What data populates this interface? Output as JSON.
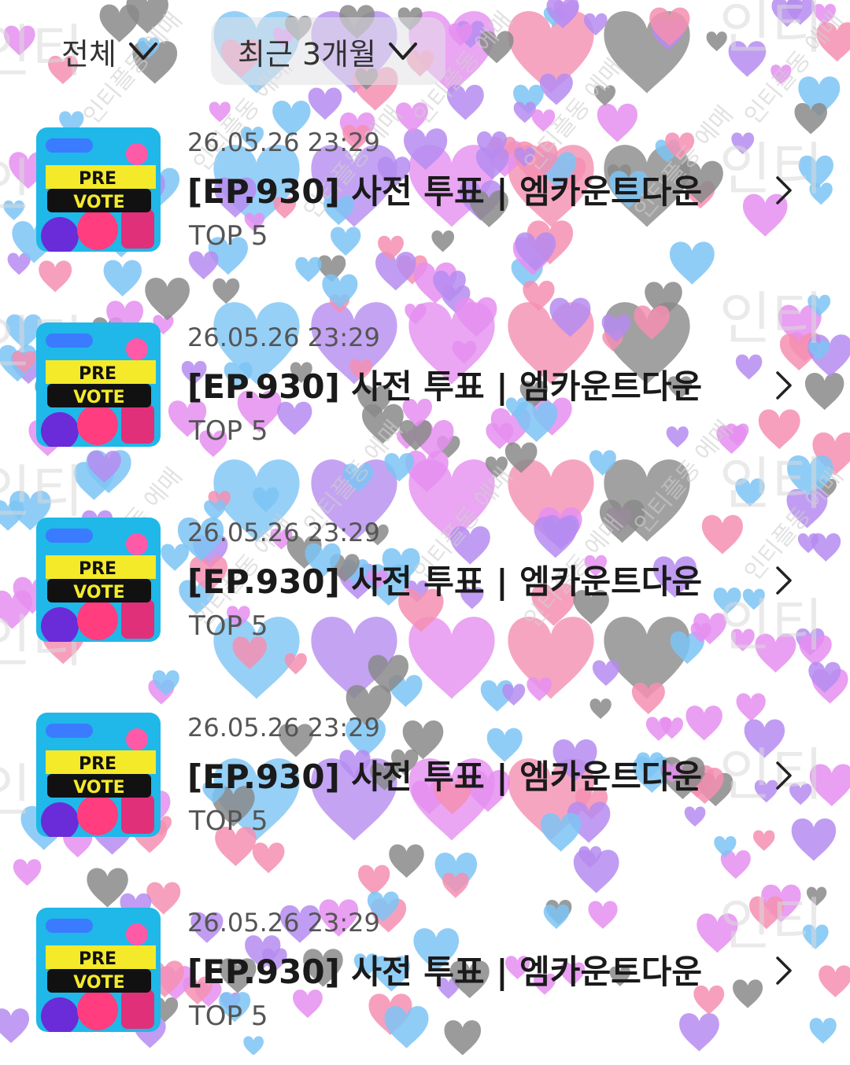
{
  "filters": {
    "type": {
      "label": "전체",
      "icon": "chevron-down-icon"
    },
    "period": {
      "label": "최근 3개월",
      "icon": "chevron-down-icon"
    }
  },
  "vote_history": [
    {
      "date": "26.05.26 23:29",
      "title": "[EP.930] 사전 투표 | 엠카운트다운",
      "detail": "TOP 5",
      "thumbnail_text": [
        "PRE",
        "VOTE"
      ],
      "icon": "chevron-right-icon"
    },
    {
      "date": "26.05.26 23:29",
      "title": "[EP.930] 사전 투표 | 엠카운트다운",
      "detail": "TOP 5",
      "thumbnail_text": [
        "PRE",
        "VOTE"
      ],
      "icon": "chevron-right-icon"
    },
    {
      "date": "26.05.26 23:29",
      "title": "[EP.930] 사전 투표 | 엠카운트다운",
      "detail": "TOP 5",
      "thumbnail_text": [
        "PRE",
        "VOTE"
      ],
      "icon": "chevron-right-icon"
    },
    {
      "date": "26.05.26 23:29",
      "title": "[EP.930] 사전 투표 | 엠카운트다운",
      "detail": "TOP 5",
      "thumbnail_text": [
        "PRE",
        "VOTE"
      ],
      "icon": "chevron-right-icon"
    },
    {
      "date": "26.05.26 23:29",
      "title": "[EP.930] 사전 투표 | 엠카운트다운",
      "detail": "TOP 5",
      "thumbnail_text": [
        "PRE",
        "VOTE"
      ],
      "icon": "chevron-right-icon"
    }
  ],
  "watermark": {
    "text": "인티플동 에매"
  },
  "colors": {
    "heart_blue": "#7cc4f5",
    "heart_purple": "#b58cf0",
    "heart_pink": "#f48fb1",
    "heart_magenta": "#e58ef0",
    "heart_gray": "#8a8a8a",
    "thumb_cyan": "#1fb8e8",
    "thumb_yellow": "#f4ea2a",
    "text_primary": "#1a1a1a",
    "text_secondary": "#555555"
  }
}
